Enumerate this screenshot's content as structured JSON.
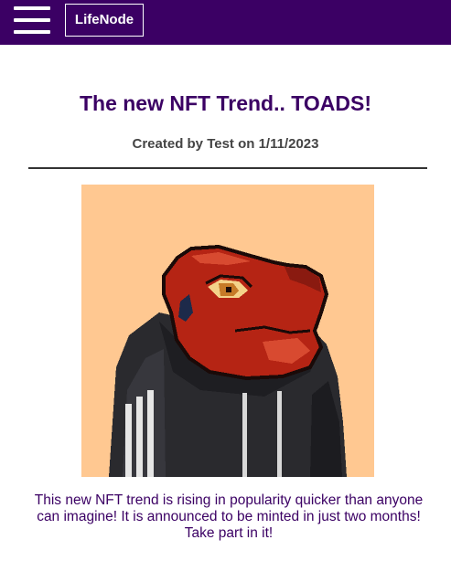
{
  "navbar": {
    "menu_icon": "hamburger-menu-icon",
    "logo_label": "LifeNode",
    "background": "#3b0064"
  },
  "article": {
    "title": "The new NFT Trend.. TOADS!",
    "byline": "Created by Test on 1/11/2023",
    "image_subject": "pixel-art red toad wearing black hoodie",
    "image_background": "#ffc891",
    "body": "This new NFT trend is rising in popularity quicker than anyone can imagine! It is announced to be minted in just two months! Take part in it!"
  },
  "colors": {
    "accent": "#3b0064",
    "toad_red": "#b52414",
    "hoodie": "#2a2a2e"
  }
}
